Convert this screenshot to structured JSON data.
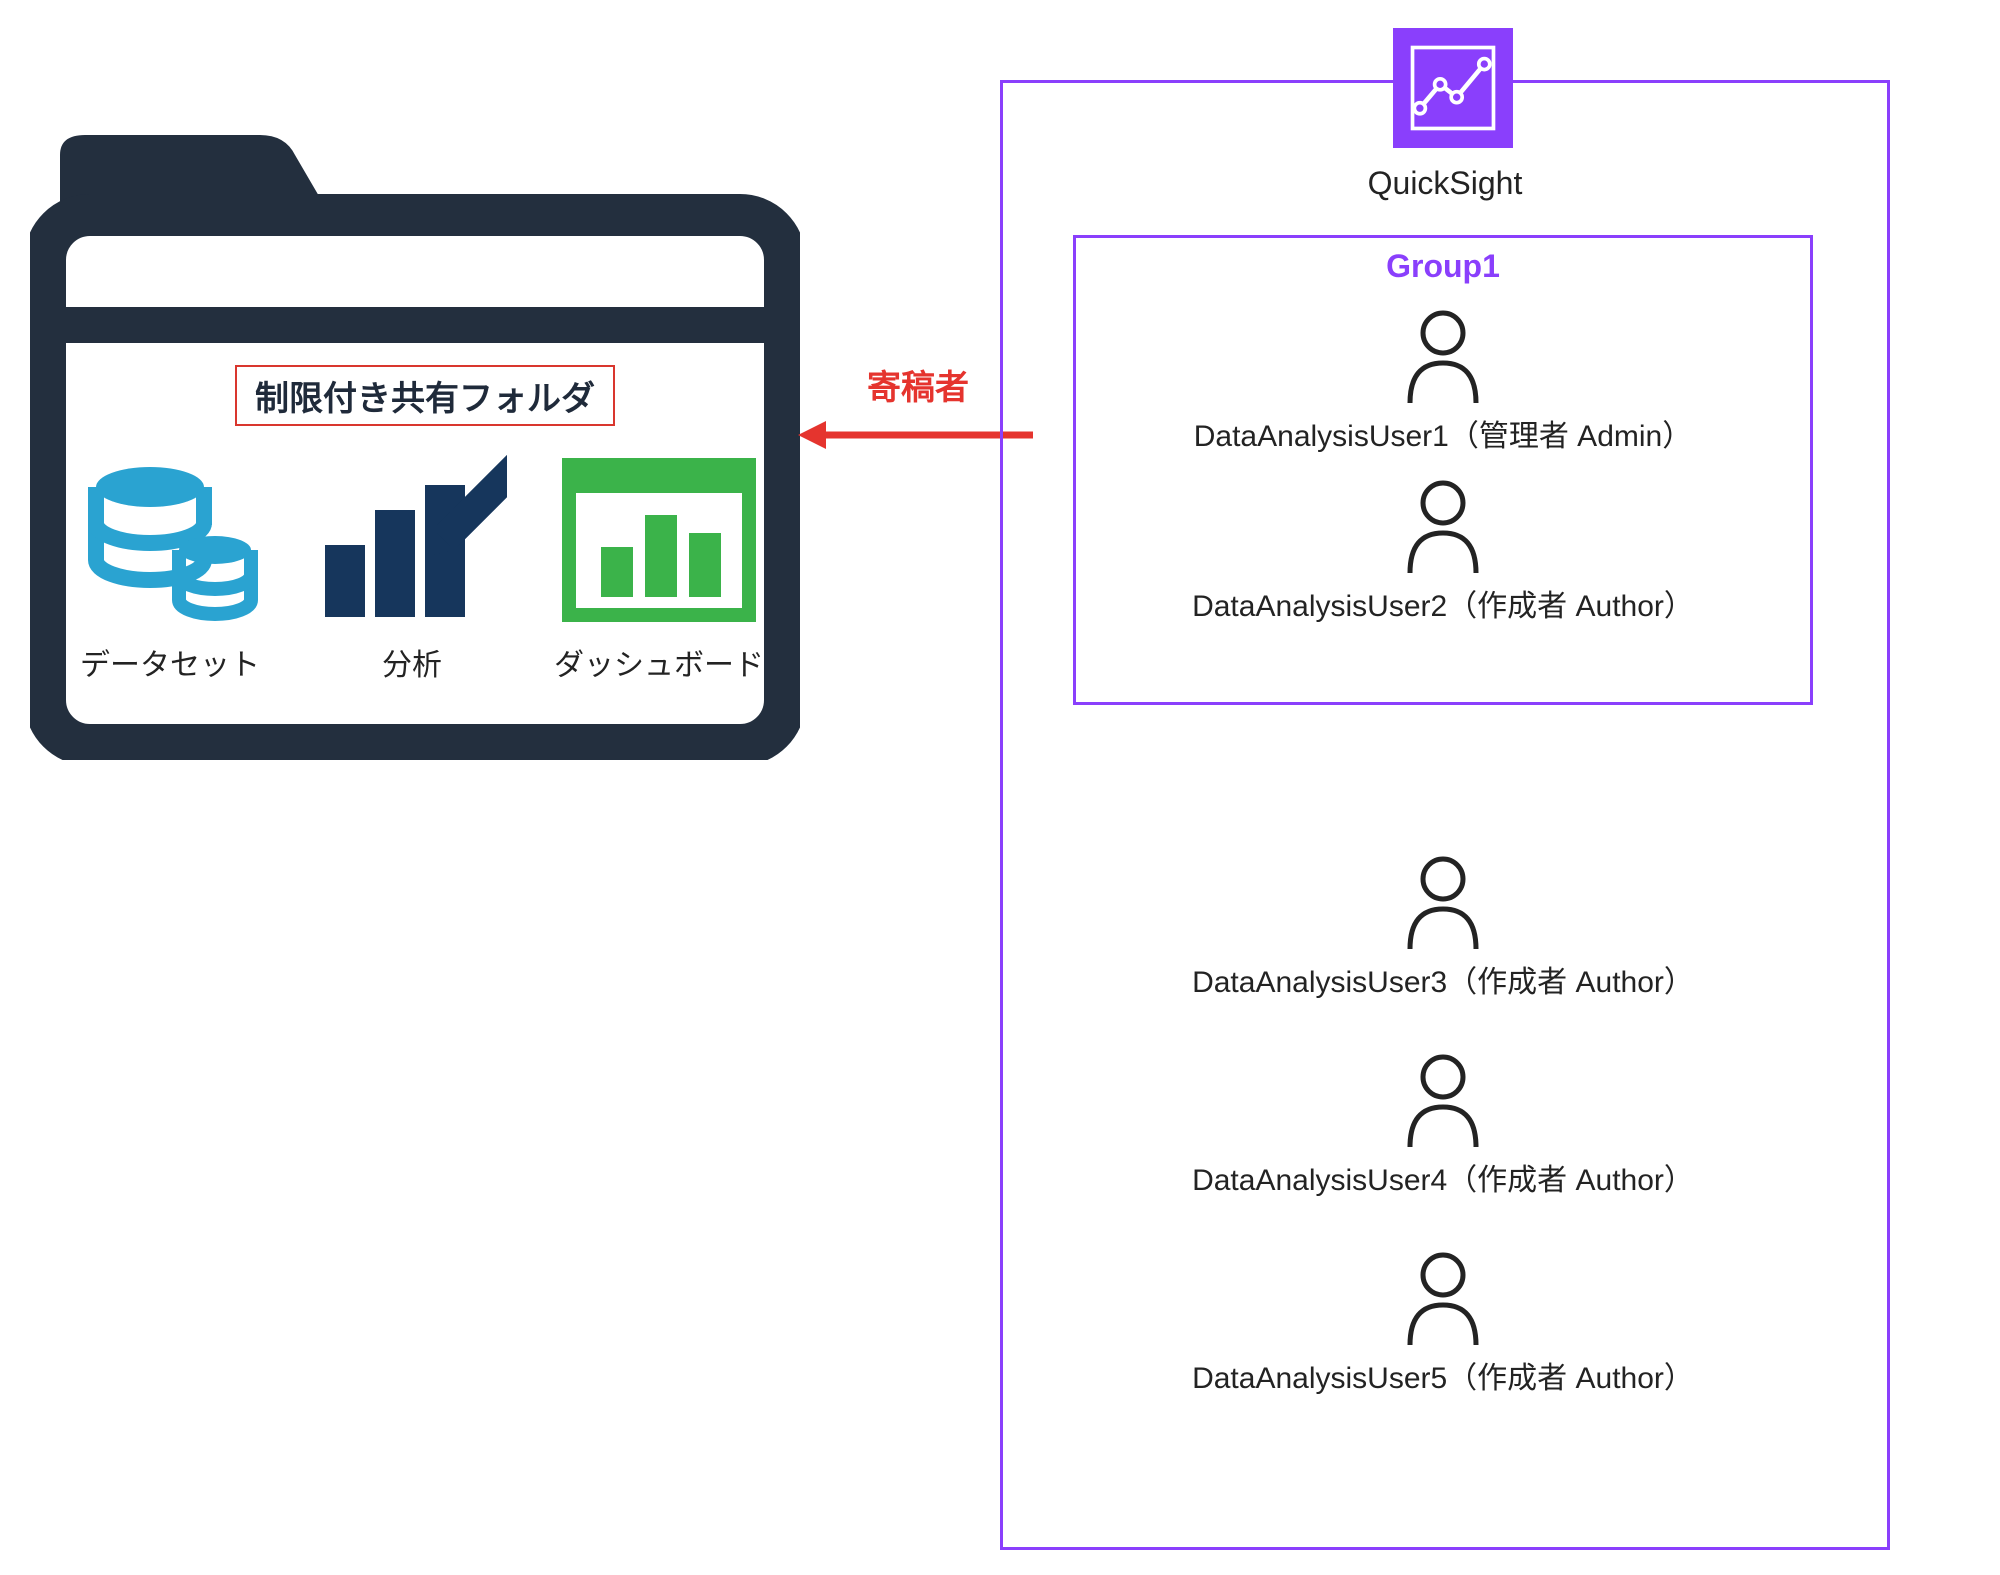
{
  "folder": {
    "title": "制限付き共有フォルダ",
    "items": [
      {
        "label": "データセット"
      },
      {
        "label": "分析"
      },
      {
        "label": "ダッシュボード"
      }
    ]
  },
  "arrow": {
    "label": "寄稿者"
  },
  "quicksight": {
    "title": "QuickSight",
    "group": {
      "name": "Group1",
      "users": [
        {
          "label": "DataAnalysisUser1（管理者 Admin）"
        },
        {
          "label": "DataAnalysisUser2（作成者 Author）"
        }
      ]
    },
    "outerUsers": [
      {
        "label": "DataAnalysisUser3（作成者 Author）"
      },
      {
        "label": "DataAnalysisUser4（作成者 Author）"
      },
      {
        "label": "DataAnalysisUser5（作成者 Author）"
      }
    ]
  },
  "colors": {
    "border": "#8a3ffc",
    "folder": "#232f3e",
    "red": "#e5342e",
    "dataset": "#2aa3d1",
    "analysis": "#16365c",
    "dashboard": "#3bb34a"
  }
}
